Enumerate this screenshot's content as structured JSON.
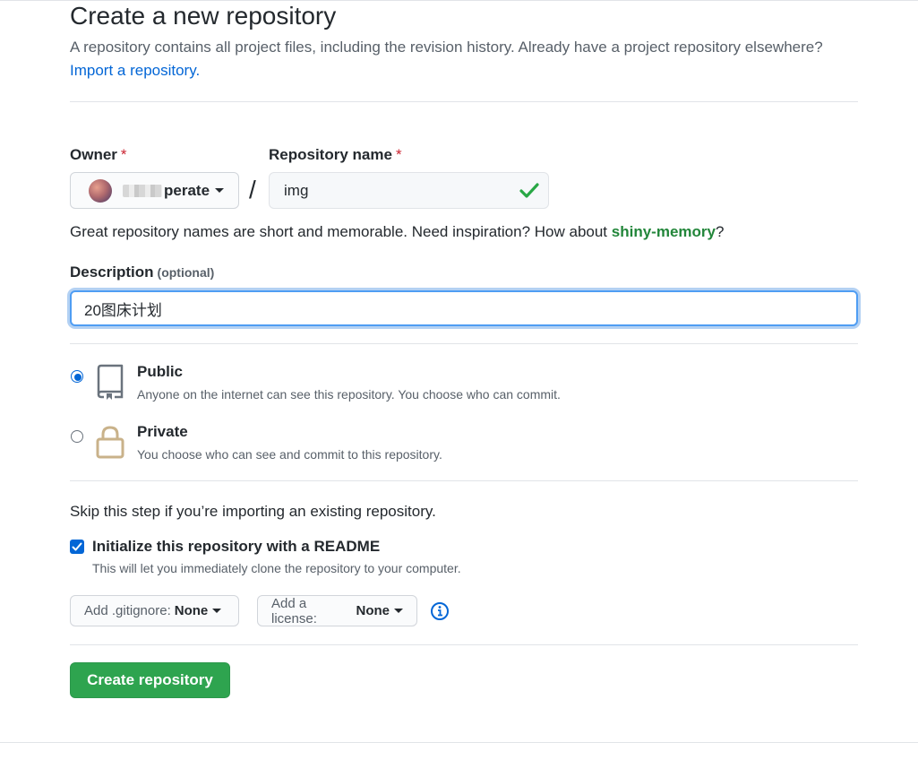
{
  "header": {
    "title": "Create a new repository",
    "subtitle": "A repository contains all project files, including the revision history. Already have a project repository elsewhere?",
    "import_link": "Import a repository."
  },
  "owner": {
    "label": "Owner",
    "required_mark": "*",
    "name": "perate"
  },
  "separator": "/",
  "repo_name": {
    "label": "Repository name",
    "required_mark": "*",
    "value": "img"
  },
  "hint": {
    "text": "Great repository names are short and memorable. Need inspiration? How about",
    "suggestion": "shiny-memory",
    "end": "?"
  },
  "description": {
    "label": "Description",
    "optional": "(optional)",
    "value": "20图床计划"
  },
  "visibility": {
    "public": {
      "title": "Public",
      "desc": "Anyone on the internet can see this repository. You choose who can commit.",
      "selected": true
    },
    "private": {
      "title": "Private",
      "desc": "You choose who can see and commit to this repository.",
      "selected": false
    }
  },
  "init": {
    "skip_text": "Skip this step if you’re importing an existing repository.",
    "readme_label": "Initialize this repository with a README",
    "readme_desc": "This will let you immediately clone the repository to your computer.",
    "readme_checked": true
  },
  "gitignore": {
    "label": "Add .gitignore:",
    "value": "None"
  },
  "license": {
    "label": "Add a license:",
    "value": "None"
  },
  "submit": {
    "label": "Create repository"
  },
  "colors": {
    "primary_button": "#2ea44f",
    "link": "#0366d6",
    "suggestion": "#22863a",
    "required": "#cb2431",
    "valid_check": "#28a745"
  }
}
